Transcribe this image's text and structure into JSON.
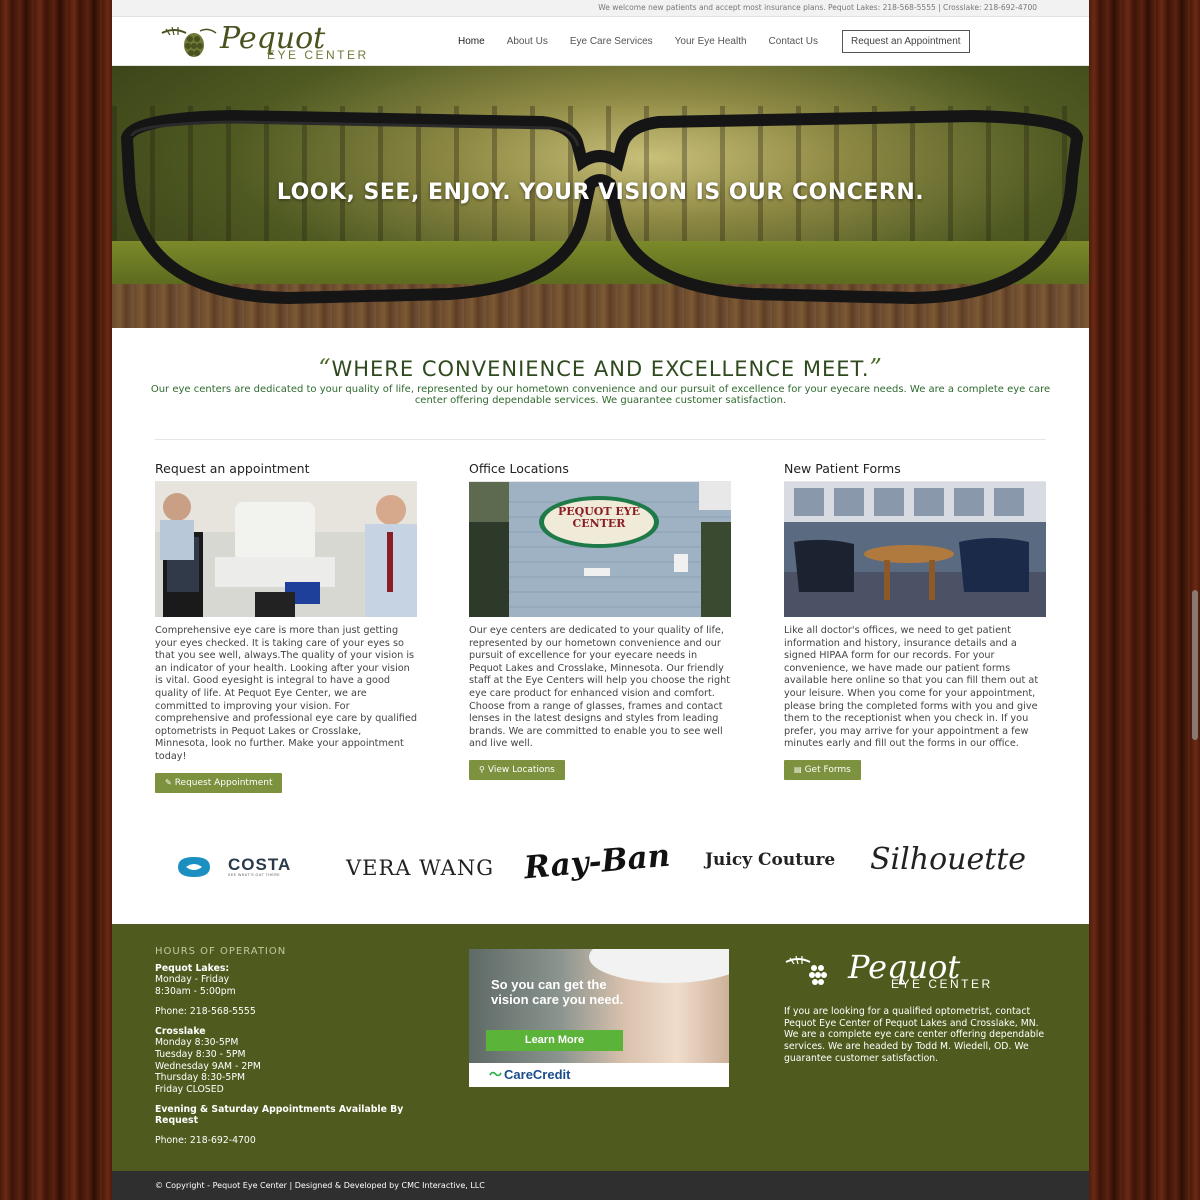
{
  "topbar": {
    "text": "We welcome new patients and accept most insurance plans. Pequot Lakes: 218-568-5555  |  Crosslake: 218-692-4700"
  },
  "logo": {
    "word": "Pequot",
    "sub": "EYE CENTER"
  },
  "nav": {
    "items": [
      "Home",
      "About Us",
      "Eye Care Services",
      "Your Eye Health",
      "Contact Us"
    ],
    "cta": "Request an Appointment"
  },
  "hero": {
    "tagline": "LOOK, SEE, ENJOY. YOUR VISION IS OUR CONCERN."
  },
  "intro": {
    "open_quote": "“",
    "title": "WHERE CONVENIENCE AND EXCELLENCE MEET.",
    "close_quote": "”",
    "text": "Our eye centers are dedicated to your quality of life, represented by our hometown convenience and our pursuit of excellence for your eyecare needs. We are a complete eye care center offering dependable services. We guarantee customer satisfaction."
  },
  "columns": [
    {
      "title": "Request an appointment",
      "text": "Comprehensive eye care is more than just getting your eyes checked. It is taking care of your eyes so that you see well, always.The quality of your vision is an indicator of your health. Looking after your vision is vital. Good eyesight is integral to have a good quality of life. At Pequot Eye Center, we are committed to improving your vision. For comprehensive and professional eye care by qualified optometrists in Pequot Lakes or Crosslake, Minnesota, look no further. Make your appointment today!",
      "button": "Request Appointment",
      "button_icon": "pencil-icon"
    },
    {
      "title": "Office Locations",
      "sign": "PEQUOT EYE CENTER",
      "text": "Our eye centers are dedicated to your quality of life, represented by our hometown convenience and our pursuit of excellence for your eyecare needs in Pequot Lakes and Crosslake, Minnesota. Our friendly staff at the Eye Centers will help you choose the right eye care product for enhanced vision and comfort. Choose from a range of glasses, frames and contact lenses in the latest designs and styles from leading brands. We are committed to enable you to see well and live well.",
      "button": "View Locations",
      "button_icon": "map-pin-icon"
    },
    {
      "title": "New Patient Forms",
      "text": "Like all doctor's offices, we need to get patient information and history, insurance details and a signed HIPAA form for our records. For your convenience, we have made our patient forms available here online so that you can fill them out at your leisure. When you come for your appointment, please bring the completed forms with you and give them to the receptionist when you check in. If you prefer, you may arrive for your appointment a few minutes early and fill out the forms in our office.",
      "button": "Get Forms",
      "button_icon": "document-icon"
    }
  ],
  "brands": {
    "costa": "COSTA",
    "costa_tag": "SEE WHAT'S OUT THERE",
    "verawang": "VERA WANG",
    "rayban": "Ray-Ban",
    "juicy": "Juicy Couture",
    "silhouette": "Silhouette"
  },
  "footer": {
    "hours_title": "HOURS OF OPERATION",
    "pequot_name": "Pequot Lakes:",
    "pequot_hours": [
      "Monday - Friday",
      "8:30am - 5:00pm"
    ],
    "pequot_phone": "Phone: 218-568-5555",
    "cross_name": "Crosslake",
    "cross_hours": [
      "Monday 8:30-5PM",
      "Tuesday 8:30 - 5PM",
      "Wednesday 9AM - 2PM",
      "Thursday 8:30-5PM",
      "Friday CLOSED"
    ],
    "evening": "Evening & Saturday Appointments Available By Request",
    "cross_phone": "Phone: 218-692-4700",
    "ad": {
      "headline": "So you can get the vision care you need.",
      "button": "Learn More",
      "brand": "CareCredit"
    },
    "logo_word": "Pequot",
    "logo_sub": "EYE CENTER",
    "about": "If you are looking for a qualified optometrist, contact Pequot Eye Center of Pequot Lakes and Crosslake, MN. We are a complete eye care center offering dependable services. We are headed by Todd M. Wiedell, OD. We guarantee customer satisfaction.",
    "copyright": "© Copyright - Pequot Eye Center  |  Designed & Developed by CMC Interactive, LLC"
  },
  "colors": {
    "brand_green": "#4f5b1e",
    "button_green": "#7d923f",
    "heading_green": "#2f4a1e",
    "footer_bar": "#2f2f2f"
  }
}
